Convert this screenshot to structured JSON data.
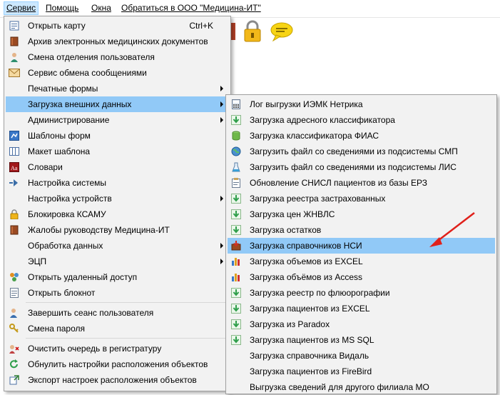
{
  "menubar": {
    "items": [
      {
        "label": "Сервис"
      },
      {
        "label": "Помощь"
      },
      {
        "label": "Окна"
      },
      {
        "label": "Обратиться в ООО \"Медицина-ИТ\""
      }
    ]
  },
  "service_menu": {
    "items": [
      {
        "label": "Открыть карту",
        "shortcut": "Ctrl+K",
        "icon": "open-card-icon"
      },
      {
        "label": "Архив электронных медицинских документов",
        "icon": "book-icon"
      },
      {
        "label": "Смена отделения пользователя",
        "icon": "user-icon"
      },
      {
        "label": "Сервис обмена сообщениями",
        "icon": "envelope-icon"
      },
      {
        "label": "Печатные формы",
        "submenu": true
      },
      {
        "label": "Загрузка внешних данных",
        "submenu": true
      },
      {
        "label": "Администрирование",
        "submenu": true
      },
      {
        "label": "Шаблоны форм",
        "icon": "form-template-icon"
      },
      {
        "label": "Макет шаблона",
        "icon": "layout-icon"
      },
      {
        "label": "Словари",
        "icon": "dictionary-icon"
      },
      {
        "label": "Настройка системы",
        "icon": "settings-arrow-icon"
      },
      {
        "label": "Настройка устройств",
        "submenu": true
      },
      {
        "label": "Блокировка КСАМУ",
        "icon": "lock-icon"
      },
      {
        "label": "Жалобы руководству Медицина-ИТ",
        "icon": "book-icon"
      },
      {
        "label": "Обработка данных",
        "submenu": true
      },
      {
        "label": "ЭЦП",
        "submenu": true
      },
      {
        "label": "Открыть удаленный доступ",
        "icon": "remote-access-icon"
      },
      {
        "label": "Открыть блокнот",
        "icon": "notepad-icon"
      },
      {
        "label": "Завершить сеанс пользователя",
        "icon": "end-session-icon"
      },
      {
        "label": "Смена пароля",
        "icon": "key-icon"
      },
      {
        "label": "Очистить очередь в регистратуру",
        "icon": "clear-queue-icon"
      },
      {
        "label": "Обнулить настройки расположения объектов",
        "icon": "reset-icon"
      },
      {
        "label": "Экспорт настроек расположения объектов",
        "icon": "export-icon"
      }
    ]
  },
  "load_submenu": {
    "items": [
      {
        "label": "Лог выгрузки ИЭМК Нетрика",
        "icon": "calculator-icon"
      },
      {
        "label": "Загрузка адресного классификатора",
        "icon": "download-arrow-icon"
      },
      {
        "label": "Загрузка классификатора ФИАС",
        "icon": "database-icon"
      },
      {
        "label": "Загрузить файл со сведениями из подсистемы СМП",
        "icon": "globe-icon"
      },
      {
        "label": "Загрузить файл со сведениями из подсистемы ЛИС",
        "icon": "flask-icon"
      },
      {
        "label": "Обновление СНИСЛ пациентов из базы ЕРЗ",
        "icon": "clipboard-icon"
      },
      {
        "label": "Загрузка реестра застрахованных",
        "icon": "download-arrow-icon"
      },
      {
        "label": "Загрузка цен ЖНВЛС",
        "icon": "download-arrow-icon"
      },
      {
        "label": "Загрузка остатков",
        "icon": "download-arrow-icon"
      },
      {
        "label": "Загрузка справочников НСИ",
        "icon": "nsi-load-icon"
      },
      {
        "label": "Загрузка объемов из EXCEL",
        "icon": "volume-chart-icon"
      },
      {
        "label": "Загрузка объёмов из Access",
        "icon": "volume-chart-icon"
      },
      {
        "label": "Загрузка реестр по флюорографии",
        "icon": "download-arrow-icon"
      },
      {
        "label": "Загрузка пациентов из EXCEL",
        "icon": "download-arrow-icon"
      },
      {
        "label": "Загрузка из Paradox",
        "icon": "download-arrow-icon"
      },
      {
        "label": "Загрузка пациентов из MS SQL",
        "icon": "download-arrow-icon"
      },
      {
        "label": "Загрузка справочника Видаль",
        "icon": ""
      },
      {
        "label": "Загрузка пациентов из FireBird",
        "icon": ""
      },
      {
        "label": "Выгрузка сведений для другого филиала МО",
        "icon": ""
      }
    ]
  },
  "colors": {
    "highlight": "#91c9f7",
    "menu_bg": "#f2f2f2",
    "annotation_arrow": "#e0201a"
  }
}
